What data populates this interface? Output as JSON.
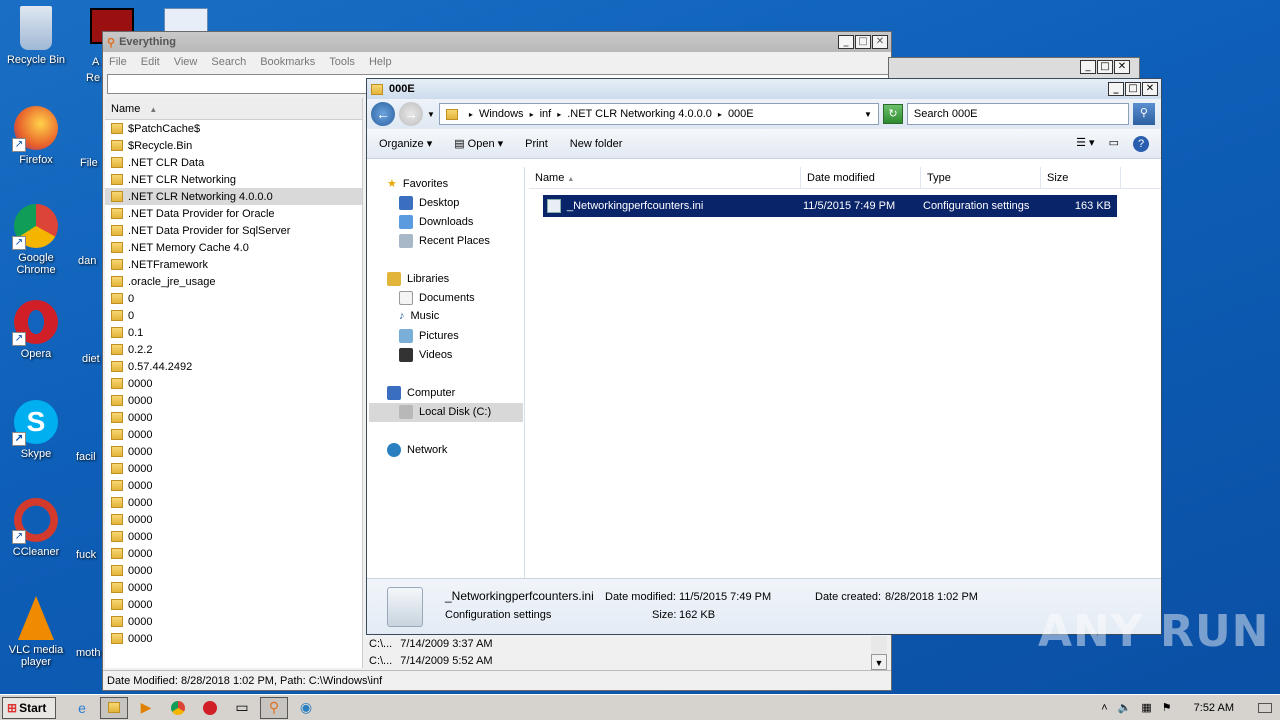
{
  "desktop": {
    "icons": [
      {
        "label": "Recycle Bin",
        "icon": "recycle-bin-icon",
        "color": "#9fb8d4"
      },
      {
        "label": "Firefox",
        "icon": "firefox-icon",
        "color": "#e8602a"
      },
      {
        "label": "Google Chrome",
        "icon": "chrome-icon",
        "color": "#3aa757"
      },
      {
        "label": "Opera",
        "icon": "opera-icon",
        "color": "#d01f27"
      },
      {
        "label": "Skype",
        "icon": "skype-icon",
        "color": "#00aff0"
      },
      {
        "label": "CCleaner",
        "icon": "ccleaner-icon",
        "color": "#d33a2c"
      },
      {
        "label": "VLC media player",
        "icon": "vlc-icon",
        "color": "#f08a00"
      }
    ],
    "partial_labels": [
      "A",
      "Re",
      "File",
      "dan",
      "diet",
      "facil",
      "fuck",
      "moth"
    ]
  },
  "everything": {
    "title": "Everything",
    "menu": [
      "File",
      "Edit",
      "View",
      "Search",
      "Bookmarks",
      "Tools",
      "Help"
    ],
    "column_name": "Name",
    "rows": [
      "$PatchCache$",
      "$Recycle.Bin",
      ".NET CLR Data",
      ".NET CLR Networking",
      ".NET CLR Networking 4.0.0.0",
      ".NET Data Provider for Oracle",
      ".NET Data Provider for SqlServer",
      ".NET Memory Cache 4.0",
      ".NETFramework",
      ".oracle_jre_usage",
      "0",
      "0",
      "0.1",
      "0.2.2",
      "0.57.44.2492",
      "0000",
      "0000",
      "0000",
      "0000",
      "0000",
      "0000",
      "0000",
      "0000",
      "0000",
      "0000",
      "0000",
      "0000",
      "0000",
      "0000",
      "0000",
      "0000"
    ],
    "selected_index": 4,
    "extra_rows": [
      {
        "path": "C:\\...",
        "date": "7/14/2009 3:37 AM"
      },
      {
        "path": "C:\\...",
        "date": "7/14/2009 5:52 AM"
      }
    ],
    "status": "Date Modified: 8/28/2018 1:02 PM, Path: C:\\Windows\\inf"
  },
  "explorer": {
    "title": "000E",
    "breadcrumb": [
      "Windows",
      "inf",
      ".NET CLR Networking 4.0.0.0",
      "000E"
    ],
    "search_placeholder": "Search 000E",
    "toolbar": {
      "organize": "Organize",
      "open": "Open",
      "print": "Print",
      "new_folder": "New folder"
    },
    "nav": {
      "favorites": "Favorites",
      "desktop": "Desktop",
      "downloads": "Downloads",
      "recent": "Recent Places",
      "libraries": "Libraries",
      "documents": "Documents",
      "music": "Music",
      "pictures": "Pictures",
      "videos": "Videos",
      "computer": "Computer",
      "local_disk": "Local Disk (C:)",
      "network": "Network"
    },
    "columns": {
      "name": "Name",
      "date": "Date modified",
      "type": "Type",
      "size": "Size"
    },
    "file": {
      "name": "_Networkingperfcounters.ini",
      "date": "11/5/2015 7:49 PM",
      "type": "Configuration settings",
      "size": "163 KB"
    },
    "details": {
      "name": "_Networkingperfcounters.ini",
      "modified_label": "Date modified:",
      "modified": "11/5/2015 7:49 PM",
      "created_label": "Date created:",
      "created": "8/28/2018 1:02 PM",
      "type": "Configuration settings",
      "size_label": "Size:",
      "size": "162 KB"
    }
  },
  "taskbar": {
    "start": "Start",
    "clock": "7:52 AM"
  },
  "watermark": "ANY RUN"
}
